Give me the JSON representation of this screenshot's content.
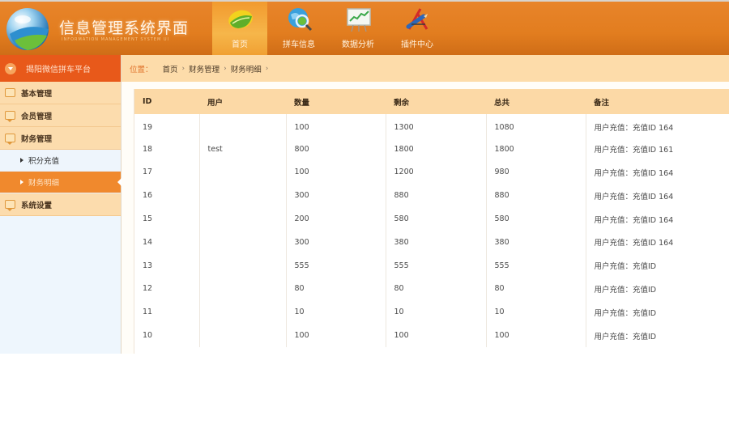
{
  "header": {
    "title": "信息管理系统界面",
    "subtitle": "INFORMATION MANAGEMENT SYSTEM UI",
    "nav": [
      {
        "label": "首页",
        "icon": "home-leaf-icon",
        "active": true
      },
      {
        "label": "拼车信息",
        "icon": "globe-search-icon",
        "active": false
      },
      {
        "label": "数据分析",
        "icon": "chart-board-icon",
        "active": false
      },
      {
        "label": "插件中心",
        "icon": "plugin-tools-icon",
        "active": false
      }
    ]
  },
  "sidebar": {
    "platform": "揭阳微信拼车平台",
    "menu": [
      {
        "label": "基本管理"
      },
      {
        "label": "会员管理"
      },
      {
        "label": "财务管理"
      },
      {
        "label": "系统设置"
      }
    ],
    "submenu": [
      {
        "label": "积分充值",
        "active": false
      },
      {
        "label": "财务明细",
        "active": true
      }
    ]
  },
  "breadcrumb": {
    "label": "位置：",
    "items": [
      "首页",
      "财务管理",
      "财务明细"
    ],
    "separator": "›"
  },
  "table": {
    "columns": [
      "ID",
      "用户",
      "数量",
      "剩余",
      "总共",
      "备注"
    ],
    "rows": [
      [
        "19",
        "",
        "100",
        "1300",
        "1080",
        "用户充值：充值ID 164"
      ],
      [
        "18",
        "test",
        "800",
        "1800",
        "1800",
        "用户充值：充值ID 161"
      ],
      [
        "17",
        "",
        "100",
        "1200",
        "980",
        "用户充值：充值ID 164"
      ],
      [
        "16",
        "",
        "300",
        "880",
        "880",
        "用户充值：充值ID 164"
      ],
      [
        "15",
        "",
        "200",
        "580",
        "580",
        "用户充值：充值ID 164"
      ],
      [
        "14",
        "",
        "300",
        "380",
        "380",
        "用户充值：充值ID 164"
      ],
      [
        "13",
        "",
        "555",
        "555",
        "555",
        "用户充值：充值ID"
      ],
      [
        "12",
        "",
        "80",
        "80",
        "80",
        "用户充值：充值ID"
      ],
      [
        "11",
        "",
        "10",
        "10",
        "10",
        "用户充值：充值ID"
      ],
      [
        "10",
        "",
        "100",
        "100",
        "100",
        "用户充值：充值ID"
      ]
    ]
  },
  "colors": {
    "header": "#e27d1f",
    "platform": "#e8591a",
    "menu": "#fcdcad",
    "active_sub": "#f0892d",
    "table_head": "#fcd9a6"
  }
}
